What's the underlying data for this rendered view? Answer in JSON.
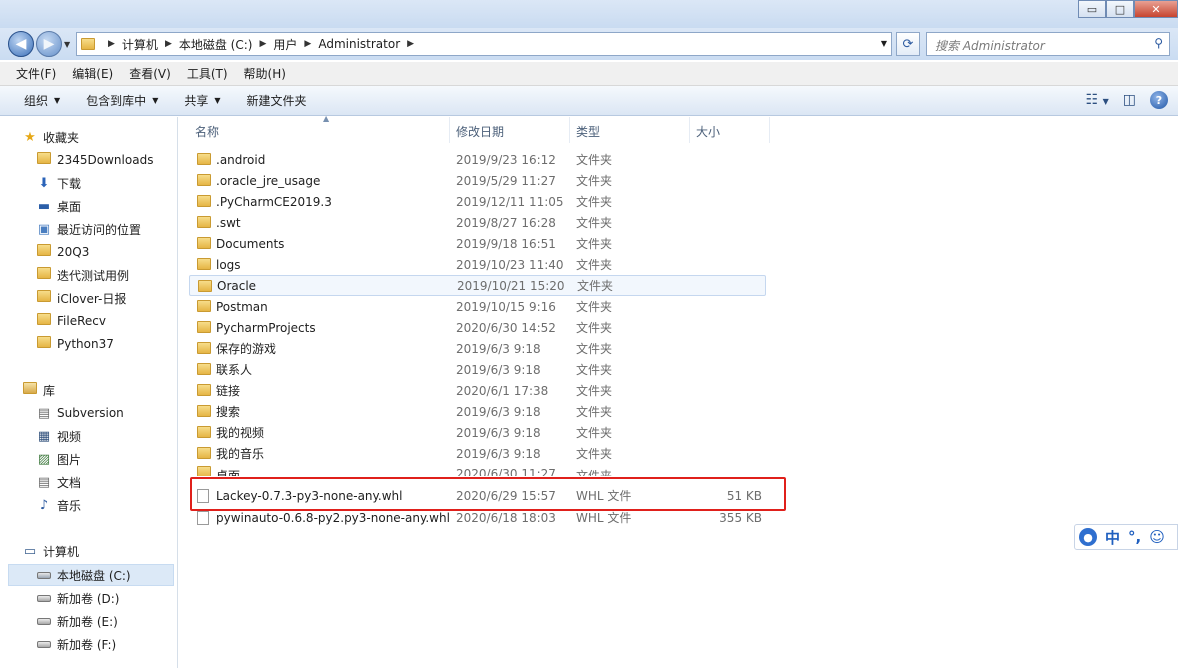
{
  "titlebar": {
    "minimize_glyph": "▭",
    "maximize_glyph": "□",
    "close_glyph": "✕"
  },
  "address": {
    "back_glyph": "◀",
    "forward_glyph": "▶",
    "crumbs": [
      "计算机",
      "本地磁盘 (C:)",
      "用户",
      "Administrator"
    ],
    "search_placeholder": "搜索 Administrator"
  },
  "menu": [
    "文件(F)",
    "编辑(E)",
    "查看(V)",
    "工具(T)",
    "帮助(H)"
  ],
  "commands": {
    "organize": "组织",
    "include_in_library": "包含到库中",
    "share": "共享",
    "new_folder": "新建文件夹"
  },
  "nav": {
    "favorites_title": "收藏夹",
    "favorites": [
      "2345Downloads",
      "下载",
      "桌面",
      "最近访问的位置",
      "20Q3",
      "迭代测试用例",
      "iClover-日报",
      "FileRecv",
      "Python37"
    ],
    "libraries_title": "库",
    "libraries": [
      "Subversion",
      "视频",
      "图片",
      "文档",
      "音乐"
    ],
    "computer_title": "计算机",
    "drives": [
      "本地磁盘 (C:)",
      "新加卷 (D:)",
      "新加卷 (E:)",
      "新加卷 (F:)"
    ]
  },
  "columns": {
    "name": "名称",
    "date": "修改日期",
    "type": "类型",
    "size": "大小"
  },
  "files": [
    {
      "name": ".android",
      "date": "2019/9/23 16:12",
      "type": "文件夹",
      "size": ""
    },
    {
      "name": ".oracle_jre_usage",
      "date": "2019/5/29 11:27",
      "type": "文件夹",
      "size": ""
    },
    {
      "name": ".PyCharmCE2019.3",
      "date": "2019/12/11 11:05",
      "type": "文件夹",
      "size": ""
    },
    {
      "name": ".swt",
      "date": "2019/8/27 16:28",
      "type": "文件夹",
      "size": ""
    },
    {
      "name": "Documents",
      "date": "2019/9/18 16:51",
      "type": "文件夹",
      "size": ""
    },
    {
      "name": "logs",
      "date": "2019/10/23 11:40",
      "type": "文件夹",
      "size": ""
    },
    {
      "name": "Oracle",
      "date": "2019/10/21 15:20",
      "type": "文件夹",
      "size": ""
    },
    {
      "name": "Postman",
      "date": "2019/10/15 9:16",
      "type": "文件夹",
      "size": ""
    },
    {
      "name": "PycharmProjects",
      "date": "2020/6/30 14:52",
      "type": "文件夹",
      "size": ""
    },
    {
      "name": "保存的游戏",
      "date": "2019/6/3 9:18",
      "type": "文件夹",
      "size": ""
    },
    {
      "name": "联系人",
      "date": "2019/6/3 9:18",
      "type": "文件夹",
      "size": ""
    },
    {
      "name": "链接",
      "date": "2020/6/1 17:38",
      "type": "文件夹",
      "size": ""
    },
    {
      "name": "搜索",
      "date": "2019/6/3 9:18",
      "type": "文件夹",
      "size": ""
    },
    {
      "name": "我的视频",
      "date": "2019/6/3 9:18",
      "type": "文件夹",
      "size": ""
    },
    {
      "name": "我的音乐",
      "date": "2019/6/3 9:18",
      "type": "文件夹",
      "size": ""
    },
    {
      "name": "桌面",
      "date": "2020/6/30 11:27",
      "type": "文件夹",
      "size": ""
    },
    {
      "name": "Lackey-0.7.3-py3-none-any.whl",
      "date": "2020/6/29 15:57",
      "type": "WHL 文件",
      "size": "51 KB"
    },
    {
      "name": "pywinauto-0.6.8-py2.py3-none-any.whl",
      "date": "2020/6/18 18:03",
      "type": "WHL 文件",
      "size": "355 KB"
    }
  ],
  "ime": {
    "mode": "中",
    "punct": "°,",
    "emoji": "☺"
  }
}
